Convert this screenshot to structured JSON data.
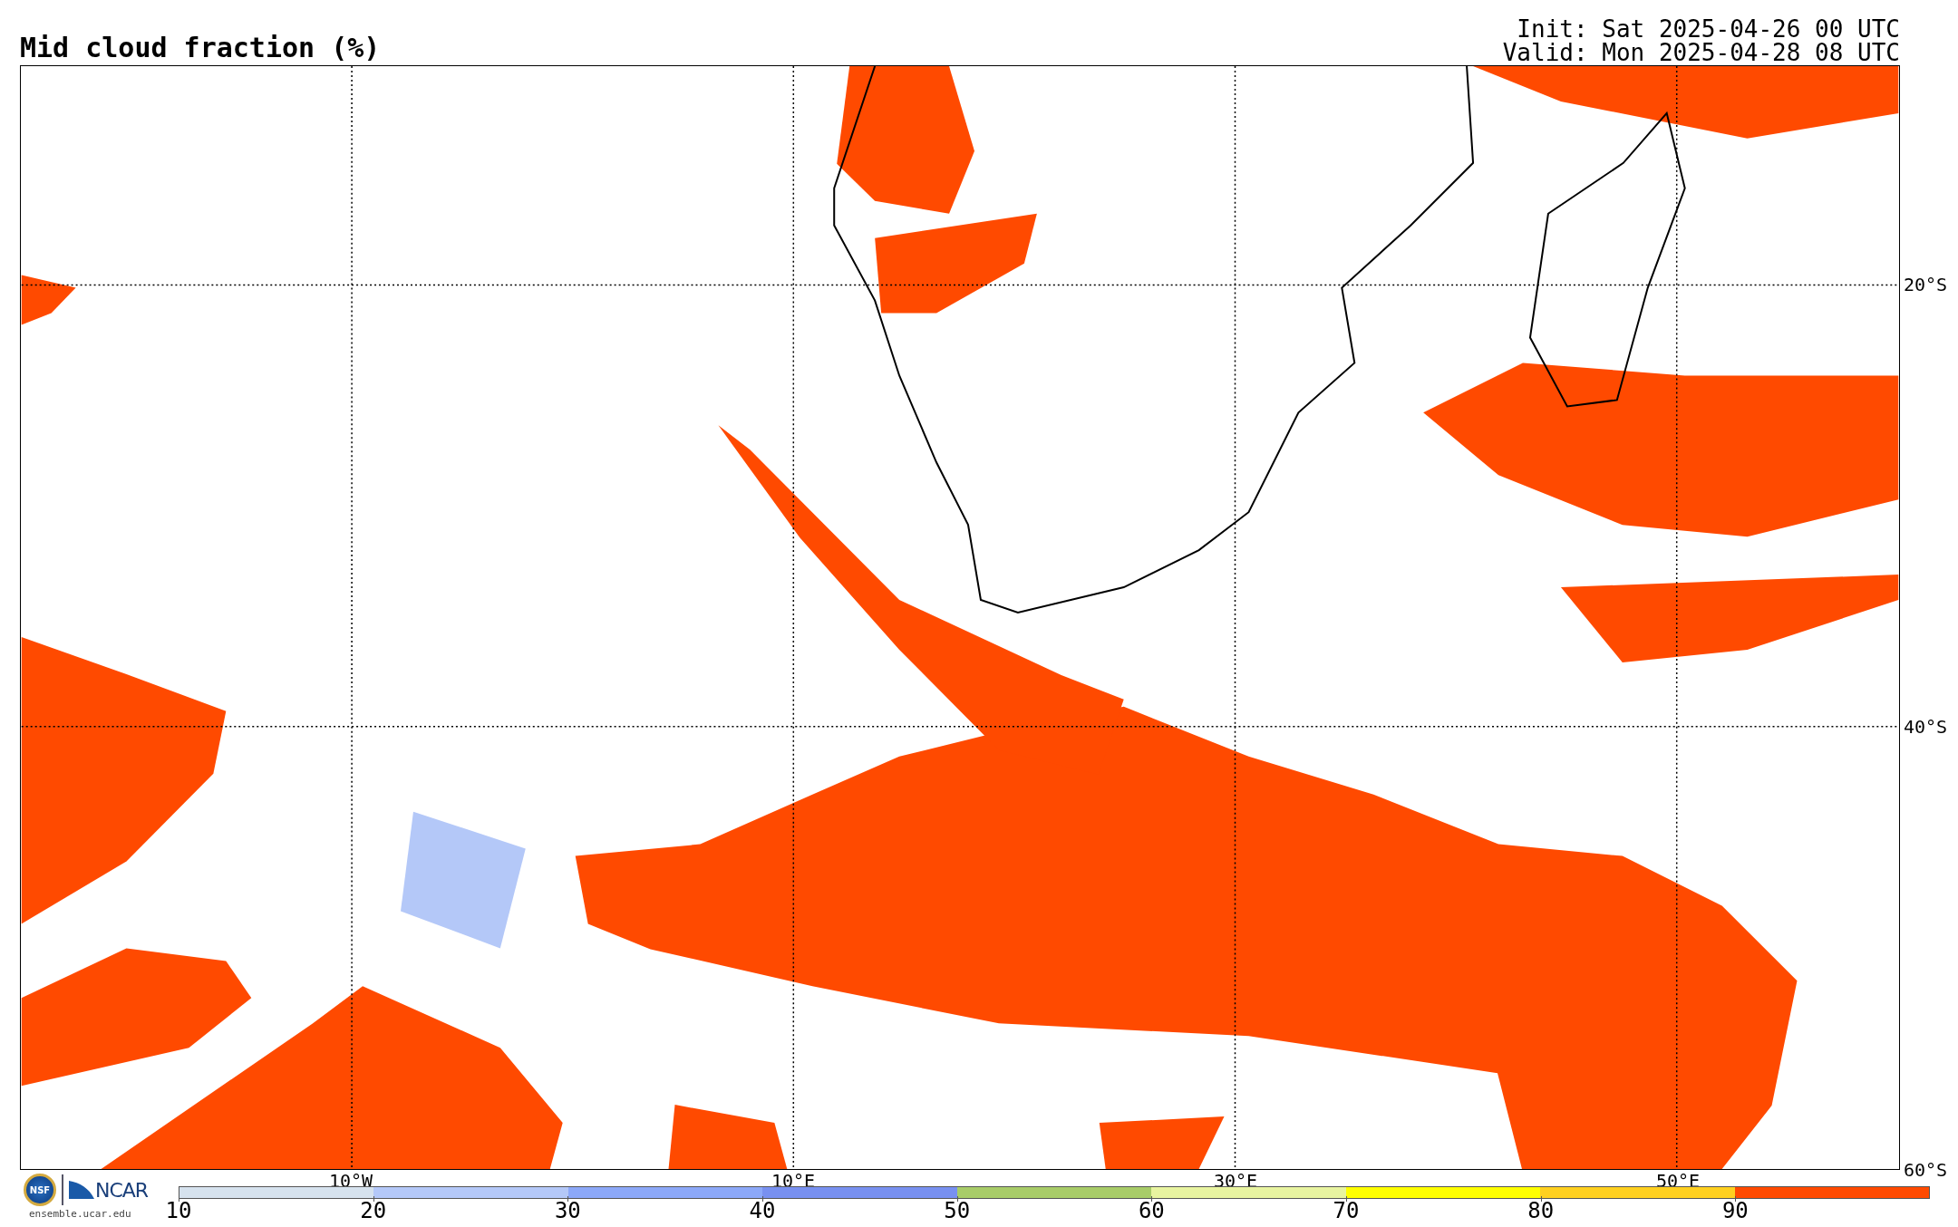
{
  "title": "Mid cloud fraction (%)",
  "init": "Init: Sat 2025-04-26 00 UTC",
  "valid": "Valid: Mon 2025-04-28 08 UTC",
  "map": {
    "lat_labels": [
      "20°S",
      "40°S",
      "60°S"
    ],
    "lon_labels": [
      "10°W",
      "10°E",
      "30°E",
      "50°E"
    ]
  },
  "logo": {
    "badge": "NSF",
    "name": "NCAR",
    "url": "ensemble.ucar.edu"
  },
  "colorbar": {
    "bins": [
      {
        "color": "#d6e2ee"
      },
      {
        "color": "#b4c8f8"
      },
      {
        "color": "#8ca8f8"
      },
      {
        "color": "#7890f0"
      },
      {
        "color": "#a8cc68"
      },
      {
        "color": "#e8f4a0"
      },
      {
        "color": "#ffff00"
      },
      {
        "color": "#ffd020"
      },
      {
        "color": "#ff4a00"
      }
    ],
    "ticks": [
      "10",
      "20",
      "30",
      "40",
      "50",
      "60",
      "70",
      "80",
      "90"
    ]
  }
}
